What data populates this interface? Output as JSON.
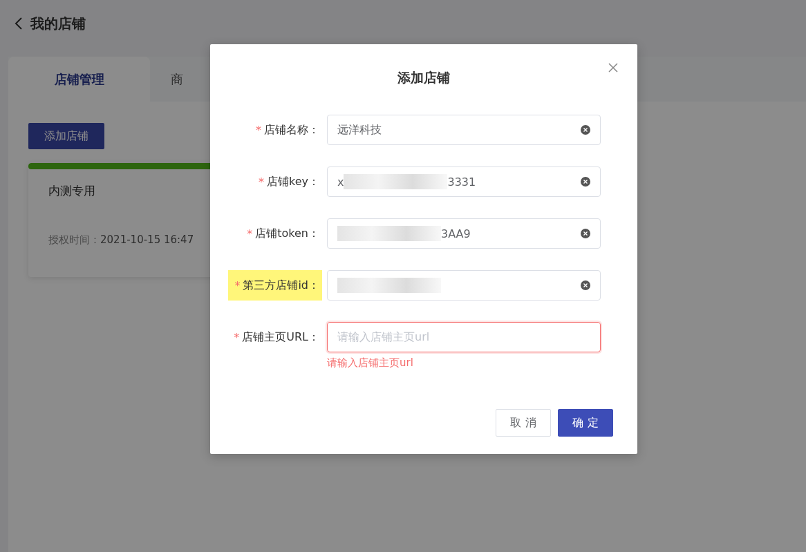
{
  "page": {
    "title": "我的店铺",
    "tabs": [
      {
        "label": "店铺管理",
        "selected": true
      },
      {
        "label": "商",
        "selected": false
      }
    ],
    "add_button": "添加店铺",
    "shop_card": {
      "name": "内测专用",
      "auth_label": "授权时间：",
      "auth_time": "2021-10-15 16:47"
    }
  },
  "dialog": {
    "title": "添加店铺",
    "fields": [
      {
        "mark": "*",
        "label": "店铺名称：",
        "highlighted": false,
        "value_start": "远洋科技",
        "redacted": false,
        "invalid": false
      },
      {
        "mark": "*",
        "label": "店铺key：",
        "highlighted": false,
        "value_start": "x",
        "redacted": true,
        "value_end": "3331",
        "invalid": false
      },
      {
        "mark": "*",
        "label": "店铺token：",
        "highlighted": false,
        "redacted": true,
        "value_end": "3AA9",
        "invalid": false
      },
      {
        "mark": "*",
        "label": "第三方店铺id：",
        "highlighted": true,
        "redacted": true,
        "invalid": false
      },
      {
        "mark": "*",
        "label": "店铺主页URL：",
        "highlighted": false,
        "redacted": false,
        "placeholder": "请输入店铺主页url",
        "invalid": true,
        "error": "请输入店铺主页url"
      }
    ],
    "buttons": [
      {
        "label": "取 消",
        "kind": "secondary"
      },
      {
        "label": "确 定",
        "kind": "primary"
      }
    ]
  }
}
